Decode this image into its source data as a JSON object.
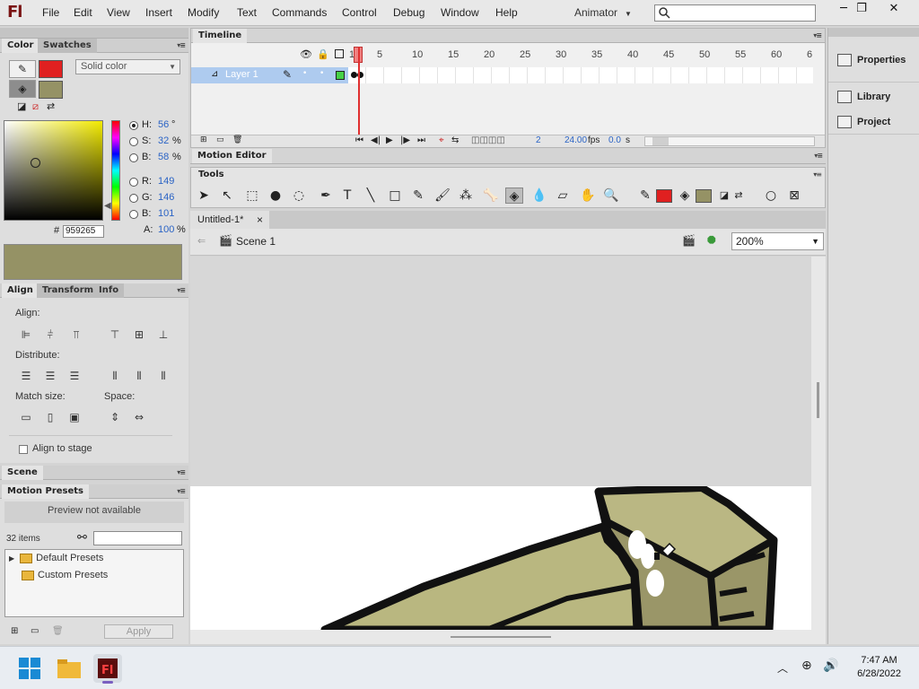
{
  "app": {
    "logo": "Fl",
    "workspace": "Animator",
    "search_placeholder": ""
  },
  "menu": [
    "File",
    "Edit",
    "View",
    "Insert",
    "Modify",
    "Text",
    "Commands",
    "Control",
    "Debug",
    "Window",
    "Help"
  ],
  "window_controls": {
    "minimize": "─",
    "restore": "❐",
    "close": "✕"
  },
  "color_panel": {
    "tabs": [
      "Color",
      "Swatches"
    ],
    "fill_type": "Solid color",
    "stroke_color": "#e02020",
    "fill_color": "#959265",
    "hsb": {
      "h": "56",
      "h_unit": "°",
      "s": "32",
      "s_unit": "%",
      "b": "58",
      "b_unit": "%"
    },
    "rgb": {
      "r": "149",
      "g": "146",
      "b": "101"
    },
    "alpha": "100",
    "alpha_unit": "%",
    "hex_label": "#",
    "hex": "959265",
    "labels": {
      "h": "H:",
      "s": "S:",
      "b": "B:",
      "r": "R:",
      "g": "G:",
      "bl": "B:",
      "a": "A:"
    }
  },
  "align_panel": {
    "tabs": [
      "Align",
      "Transform",
      "Info"
    ],
    "align_label": "Align:",
    "distribute_label": "Distribute:",
    "match_size_label": "Match size:",
    "space_label": "Space:",
    "align_to_stage": "Align to stage"
  },
  "scene_panel": {
    "title": "Scene"
  },
  "motion_presets": {
    "title": "Motion Presets",
    "preview": "Preview not available",
    "count": "32 items",
    "folders": [
      "Default Presets",
      "Custom Presets"
    ],
    "apply": "Apply"
  },
  "timeline": {
    "title": "Timeline",
    "layer_name": "Layer 1",
    "ruler": [
      "1",
      "5",
      "10",
      "15",
      "20",
      "25",
      "30",
      "35",
      "40",
      "45",
      "50",
      "55",
      "60",
      "6"
    ],
    "current_frame": "2",
    "fps": "24.00",
    "fps_unit": "fps",
    "time": "0.0",
    "time_unit": "s"
  },
  "motion_editor": {
    "title": "Motion Editor"
  },
  "tools": {
    "title": "Tools",
    "stroke_color": "#e02020",
    "fill_color": "#959265"
  },
  "document": {
    "tab": "Untitled-1*",
    "tab_close": "×",
    "scene": "Scene 1",
    "zoom": "200%"
  },
  "right_panel": [
    "Properties",
    "Library",
    "Project"
  ],
  "taskbar": {
    "time": "7:47 AM",
    "date": "6/28/2022"
  }
}
